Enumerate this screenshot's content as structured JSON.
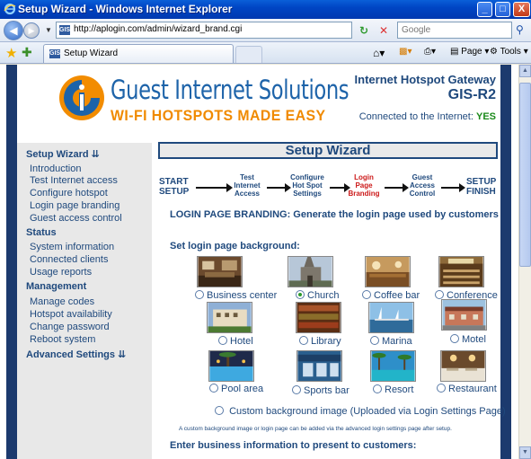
{
  "window": {
    "title": "Setup Wizard - Windows Internet Explorer",
    "minimize": "_",
    "maximize": "□",
    "close": "X"
  },
  "browser": {
    "url": "http://aplogin.com/admin/wizard_brand.cgi",
    "search_placeholder": "Google",
    "tab_title": "Setup Wizard",
    "page_menu": "Page",
    "tools_menu": "Tools"
  },
  "header": {
    "brand_name": "Guest Internet Solutions",
    "brand_tagline": "WI-FI HOTSPOTS MADE EASY",
    "product_line": "Internet Hotspot Gateway",
    "model": "GIS-R2",
    "connection_label": "Connected to the Internet:",
    "connection_status": "YES",
    "connection_color": "#1a8a1a"
  },
  "sidebar": {
    "setup_heading": "Setup Wizard ⇊",
    "setup_items": [
      "Introduction",
      "Test Internet access",
      "Configure hotspot",
      "Login page branding",
      "Guest access control"
    ],
    "status_heading": "Status",
    "status_items": [
      "System information",
      "Connected clients",
      "Usage reports"
    ],
    "management_heading": "Management",
    "management_items": [
      "Manage codes",
      "Hotspot availability",
      "Change password",
      "Reboot system"
    ],
    "advanced_heading": "Advanced Settings ⇊"
  },
  "main": {
    "title": "Setup Wizard",
    "steps": {
      "start": [
        "START",
        "SETUP"
      ],
      "s1": [
        "Test",
        "Internet",
        "Access"
      ],
      "s2": [
        "Configure",
        "Hot Spot",
        "Settings"
      ],
      "s3": [
        "Login",
        "Page",
        "Branding"
      ],
      "s4": [
        "Guest",
        "Access",
        "Control"
      ],
      "finish": [
        "SETUP",
        "FINISH"
      ]
    },
    "active_step_color": "#cc1a1a",
    "branding_heading": "LOGIN PAGE BRANDING: Generate the login page used by customers",
    "background_heading": "Set login page background:",
    "backgrounds": [
      {
        "label": "Business center",
        "selected": false
      },
      {
        "label": "Church",
        "selected": true
      },
      {
        "label": "Coffee bar",
        "selected": false
      },
      {
        "label": "Conference",
        "selected": false
      },
      {
        "label": "Hotel",
        "selected": false
      },
      {
        "label": "Library",
        "selected": false
      },
      {
        "label": "Marina",
        "selected": false
      },
      {
        "label": "Motel",
        "selected": false
      },
      {
        "label": "Pool area",
        "selected": false
      },
      {
        "label": "Sports bar",
        "selected": false
      },
      {
        "label": "Resort",
        "selected": false
      },
      {
        "label": "Restaurant",
        "selected": false
      }
    ],
    "custom_background": "Custom background image (Uploaded via Login Settings Page)",
    "custom_note": "A custom background image or login page can be added via the advanced login settings page after setup.",
    "business_heading": "Enter business information to present to customers:"
  }
}
